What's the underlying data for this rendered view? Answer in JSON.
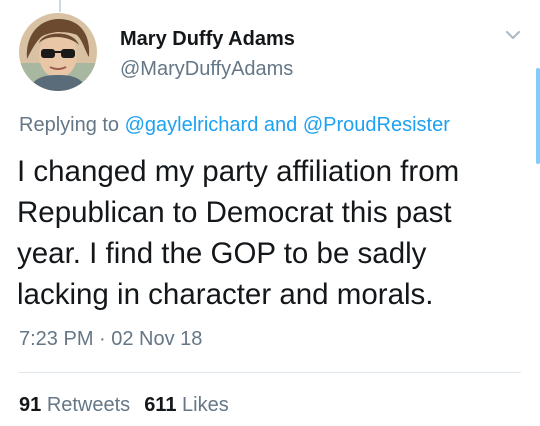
{
  "author": {
    "display_name": "Mary Duffy Adams",
    "handle": "@MaryDuffyAdams",
    "avatar_icon": "user-avatar-photo"
  },
  "reply": {
    "prefix": "Replying to",
    "mention_1": "@gaylelrichard",
    "conjunction": "and",
    "mention_2": "@ProudResister"
  },
  "tweet": {
    "lines": [
      "I changed my party affiliation from",
      "Republican to Democrat this past",
      "year. I find the GOP to be sadly",
      "lacking in character and morals."
    ],
    "timestamp": "7:23 PM · 02 Nov 18"
  },
  "stats": {
    "retweets_count": "91",
    "retweets_label": "Retweets",
    "likes_count": "611",
    "likes_label": "Likes"
  },
  "colors": {
    "link": "#1da1f2",
    "secondary_text": "#657786",
    "primary_text": "#14171a"
  },
  "icons": {
    "menu": "chevron-down-icon"
  }
}
